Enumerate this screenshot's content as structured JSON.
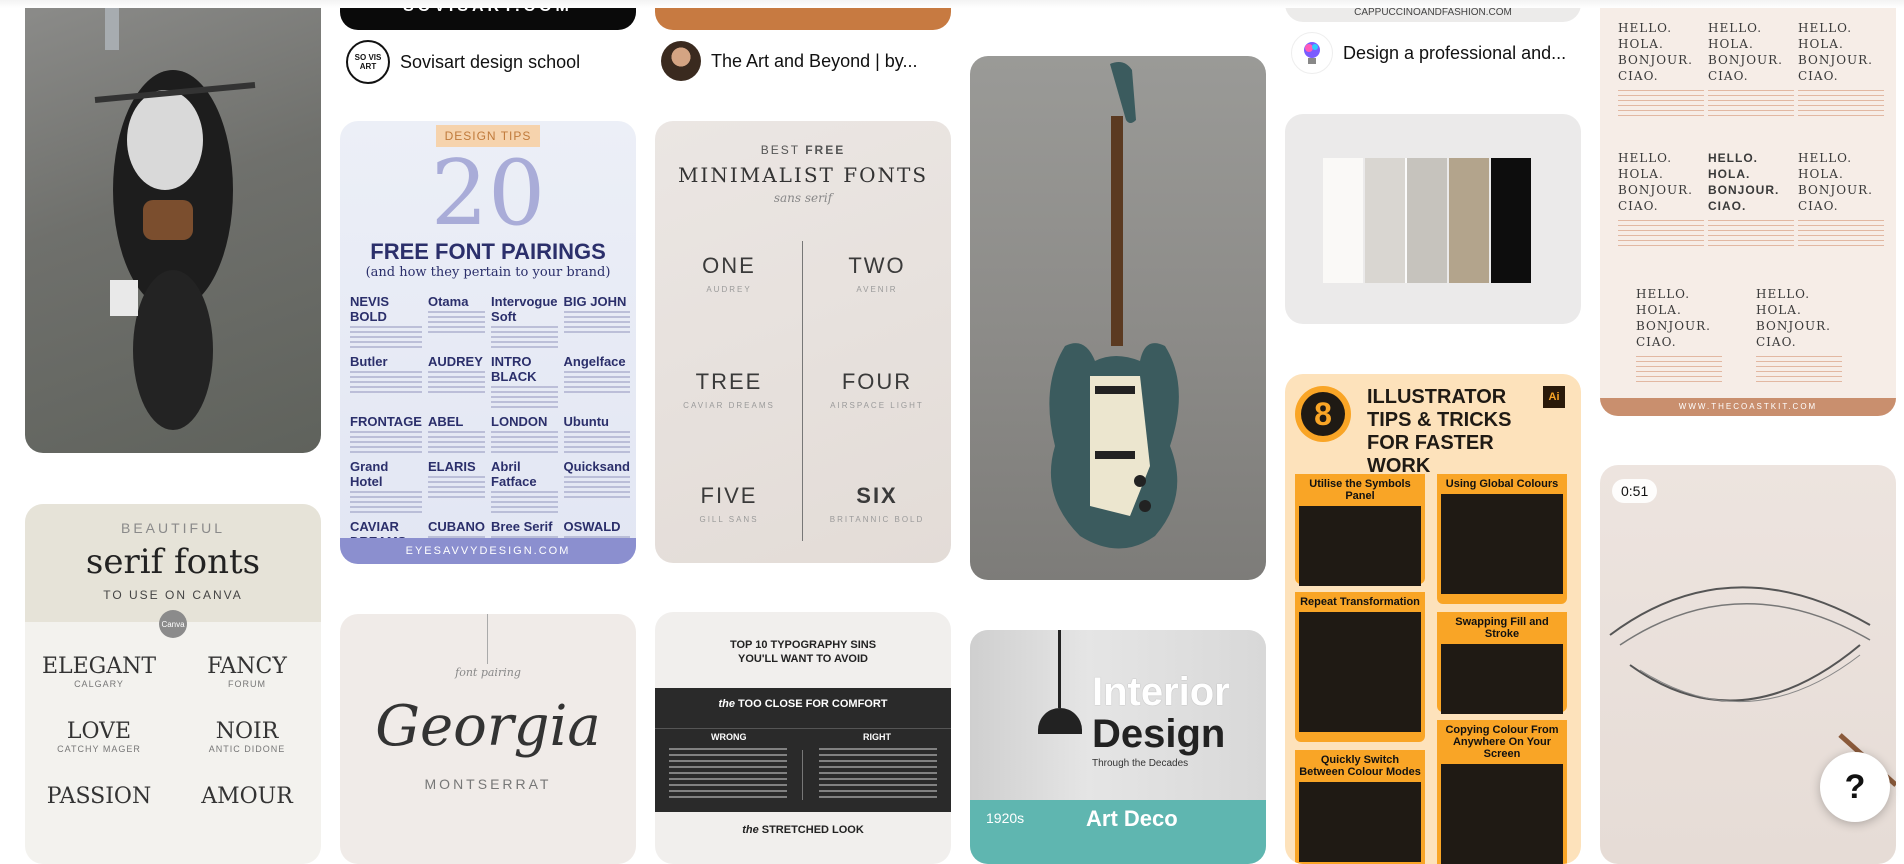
{
  "pins": {
    "sovisart": {
      "logo_text": "SOVISART.COM",
      "avatar_text": "SO VIS ART",
      "title": "Sovisart design school"
    },
    "artbeyond": {
      "title": "The Art and Beyond | by..."
    },
    "cappuccino": {
      "url_text": "CAPPUCCINOANDFASHION.COM",
      "title": "Design a professional and..."
    },
    "font_pairings": {
      "tag": "DESIGN TIPS",
      "number": "20",
      "headline": "FREE FONT PAIRINGS",
      "subline": "(and how they pertain to your brand)",
      "fonts": [
        "NEVIS BOLD",
        "Otama",
        "Intervogue Soft",
        "BIG JOHN",
        "Butler",
        "AUDREY",
        "INTRO BLACK",
        "Angelface",
        "FRONTAGE",
        "ABEL",
        "LONDON",
        "Ubuntu",
        "Grand Hotel",
        "ELARIS",
        "Abril Fatface",
        "Quicksand",
        "CAVIAR DREAMS",
        "CUBANO",
        "Bree Serif",
        "OSWALD"
      ],
      "footer": "EYESAVVYDESIGN.COM"
    },
    "minimalist": {
      "kicker_a": "BEST",
      "kicker_b": "FREE",
      "headline": "MINIMALIST FONTS",
      "script": "sans serif",
      "items": [
        {
          "word": "ONE",
          "font": "AUDREY"
        },
        {
          "word": "TWO",
          "font": "AVENIR"
        },
        {
          "word": "TREE",
          "font": "CAVIAR DREAMS"
        },
        {
          "word": "FOUR",
          "font": "AIRSPACE LIGHT"
        },
        {
          "word": "FIVE",
          "font": "GILL SANS"
        },
        {
          "word": "SIX",
          "font": "BRITANNIC BOLD"
        }
      ]
    },
    "serif_fonts": {
      "kicker": "BEAUTIFUL",
      "headline": "serif fonts",
      "sub": "TO USE ON CANVA",
      "badge": "Canva",
      "items": [
        {
          "word": "ELEGANT",
          "font": "CALGARY"
        },
        {
          "word": "FANCY",
          "font": "FORUM"
        },
        {
          "word": "LOVE",
          "font": "CATCHY MAGER"
        },
        {
          "word": "NOIR",
          "font": "ANTIC DIDONE"
        },
        {
          "word": "PASSION",
          "font": ""
        },
        {
          "word": "AMOUR",
          "font": ""
        }
      ]
    },
    "georgia": {
      "kicker": "font pairing",
      "script": "Georgia",
      "font": "MONTSERRAT"
    },
    "typography": {
      "headline": "TOP 10 TYPOGRAPHY SINS YOU'LL WANT TO AVOID",
      "band_a": "the",
      "band_b": "TOO CLOSE FOR COMFORT",
      "wrong": "WRONG",
      "right": "RIGHT",
      "footer_a": "the",
      "footer_b": "STRETCHED LOOK"
    },
    "interior": {
      "title_a": "Interior",
      "title_b": "Design",
      "sub": "Through the Decades",
      "decade": "1920s",
      "style": "Art Deco"
    },
    "illustrator": {
      "number": "8",
      "title": "ILLUSTRATOR TIPS & TRICKS FOR FASTER WORK",
      "ai": "Ai",
      "tips": [
        "Utilise the Symbols Panel",
        "Using Global Colours",
        "Repeat Transformation",
        "Swapping Fill and Stroke",
        "Quickly Switch Between Colour Modes",
        "Copying Colour From Anywhere On Your Screen"
      ]
    },
    "hello": {
      "words": [
        "HELLO.",
        "HOLA.",
        "BONJOUR.",
        "CIAO."
      ],
      "footer": "WWW.THECOASTKIT.COM"
    },
    "video": {
      "duration": "0:51"
    }
  },
  "help": {
    "label": "?"
  },
  "colors": {
    "font_pair_blue": "#2b2f6b",
    "font_pair_tag": "#e9b27d",
    "font_pair_footer": "#8b8fcf",
    "illustrator_orange": "#f9a526",
    "guitar_green": "#3b5b5e",
    "interior_teal": "#5fb6b0"
  }
}
